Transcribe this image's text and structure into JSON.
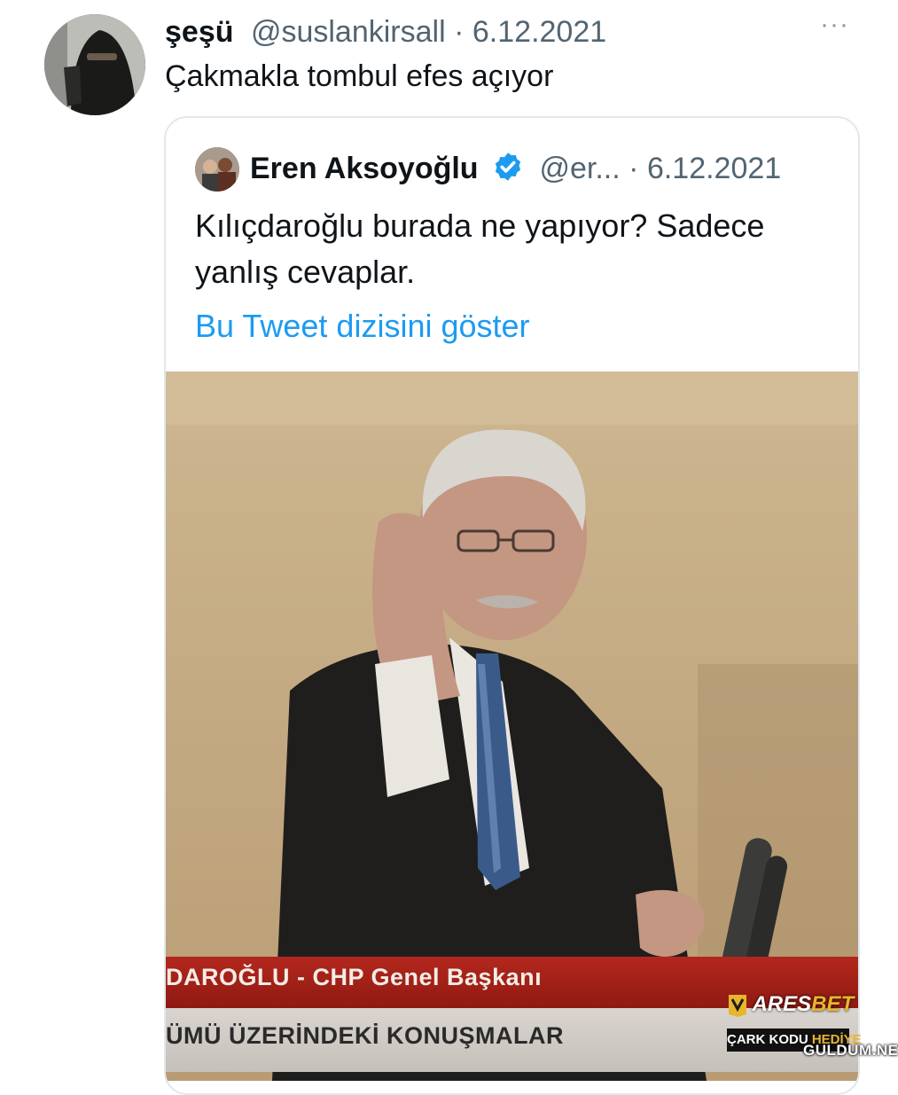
{
  "tweet": {
    "display_name": "şeşü",
    "handle": "@suslankirsall",
    "separator": "·",
    "date": "6.12.2021",
    "more_icon": "···",
    "text": "Çakmakla tombul efes açıyor"
  },
  "quoted_tweet": {
    "display_name": "Eren Aksoyoğlu",
    "verified_icon": "verified-badge-icon",
    "handle": "@er...",
    "separator": "·",
    "date": "6.12.2021",
    "text": "Kılıçdaroğlu burada ne yapıyor? Sadece yanlış cevaplar.",
    "thread_link": "Bu Tweet dizisini göster",
    "accent_color": "#1d9bf0"
  },
  "media": {
    "lower_third_line1": "DAROĞLU - CHP Genel Başkanı",
    "lower_third_line2": "ÜMÜ ÜZERİNDEKİ KONUŞMALAR",
    "brand_name_part1": "ARES",
    "brand_name_part2": "BET",
    "promo_part1": "ÇARK KODU ",
    "promo_part2": "HEDİYE",
    "watermark": "GULDUM.NET"
  }
}
